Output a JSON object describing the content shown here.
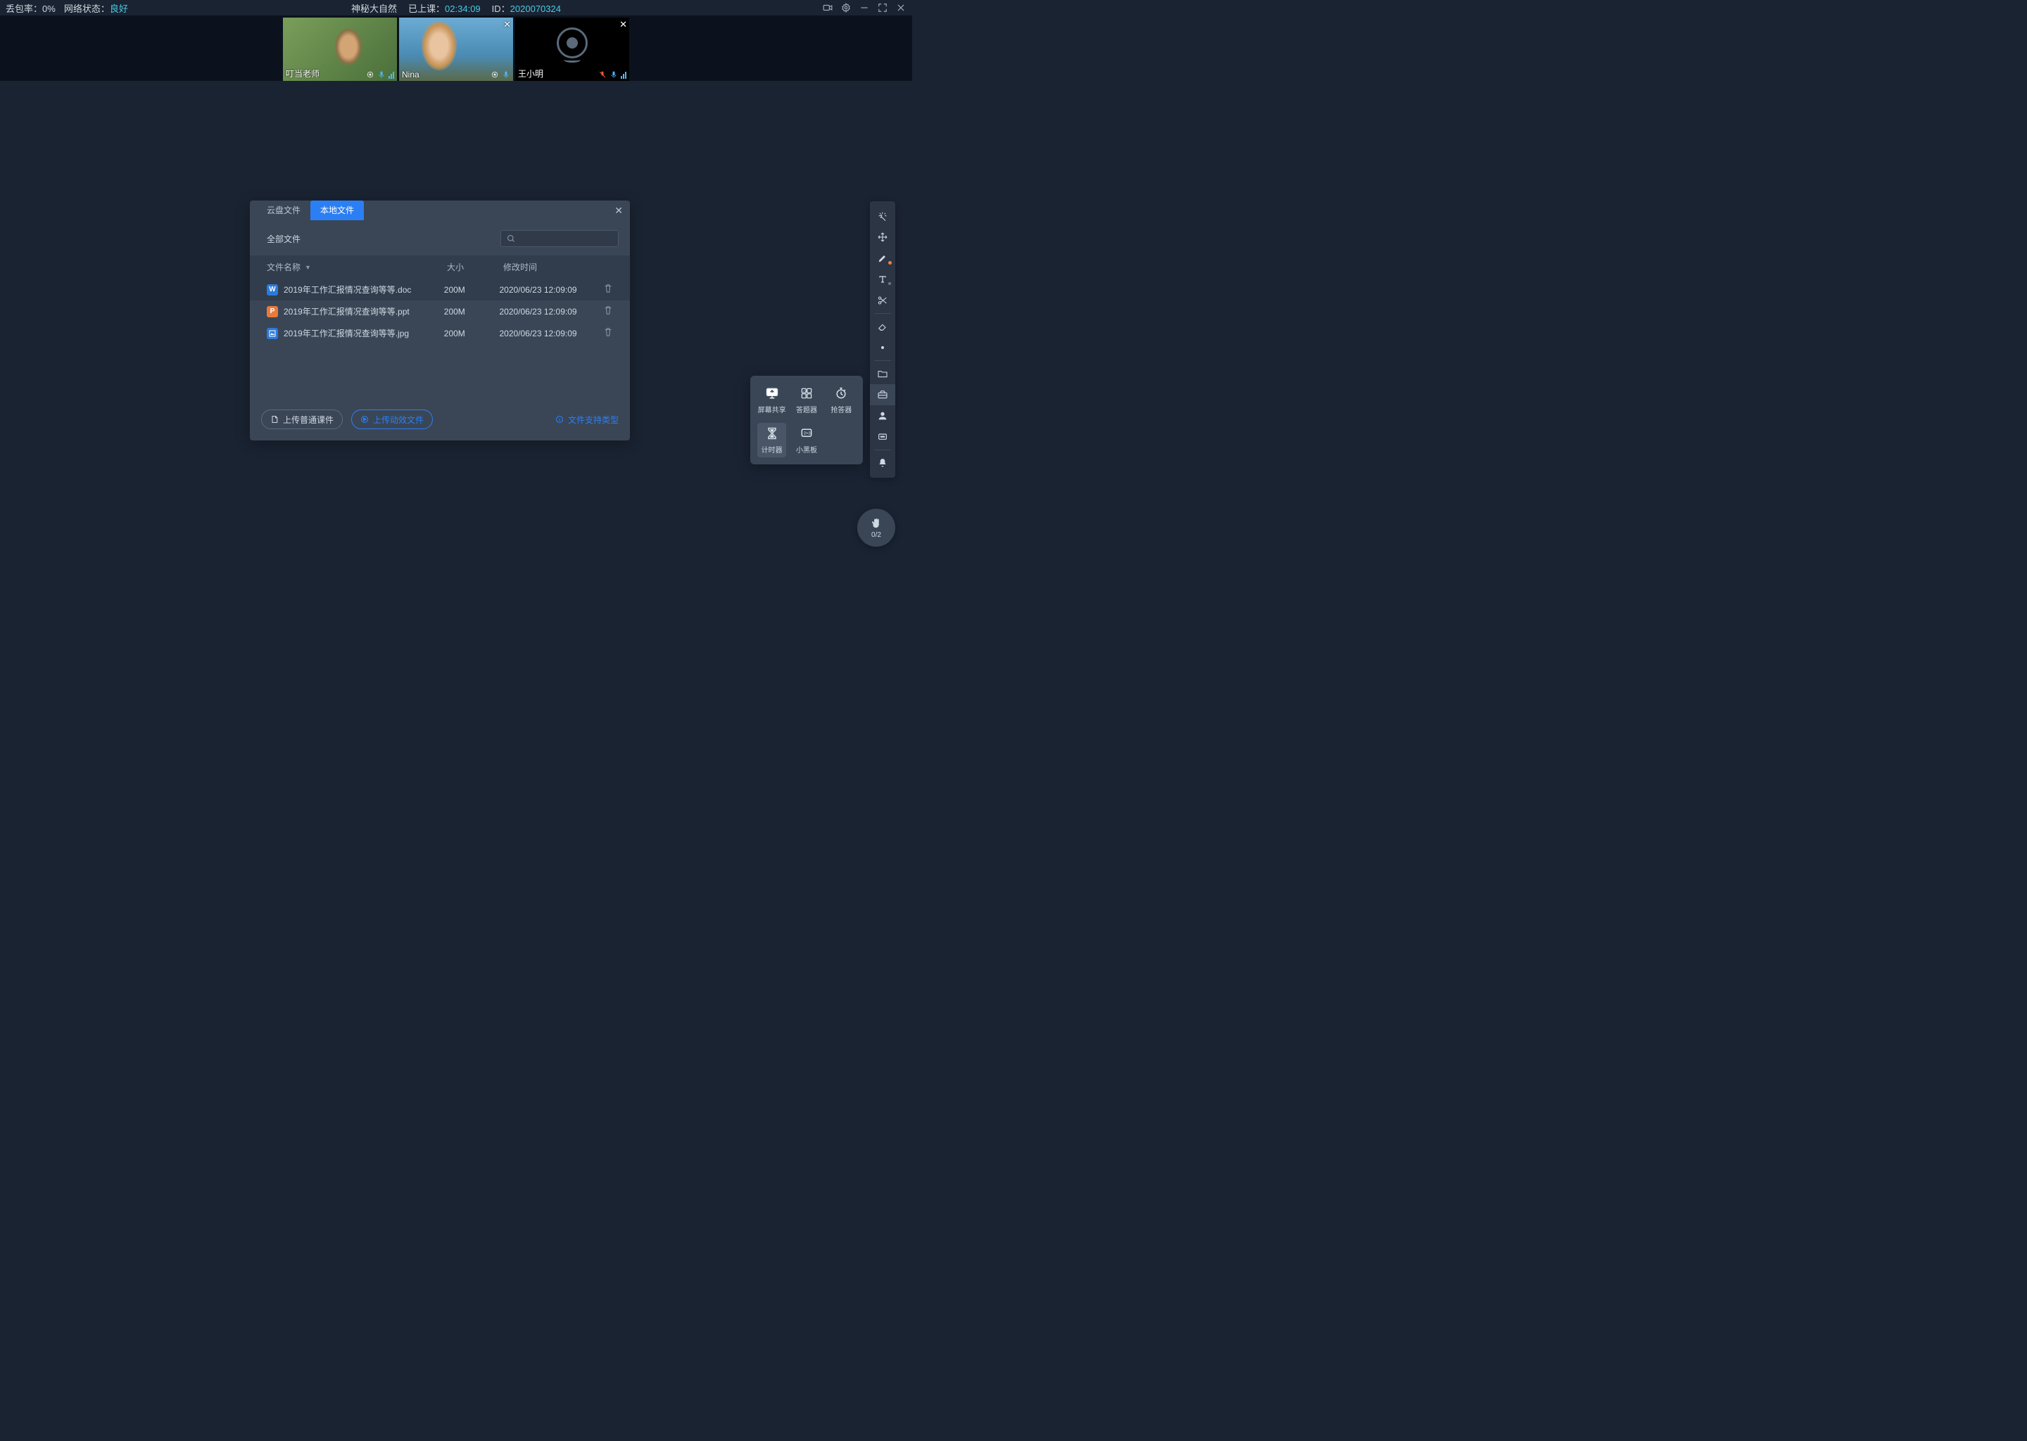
{
  "topbar": {
    "packet_loss_label": "丢包率：",
    "packet_loss_value": "0%",
    "network_label": "网络状态：",
    "network_value": "良好",
    "title": "神秘大自然",
    "elapsed_label": "已上课：",
    "elapsed_value": "02:34:09",
    "id_label": "ID：",
    "id_value": "2020070324"
  },
  "videos": [
    {
      "name": "叮当老师",
      "closable": false,
      "dark": false
    },
    {
      "name": "Nina",
      "closable": true,
      "dark": false
    },
    {
      "name": "王小明",
      "closable": true,
      "dark": true
    }
  ],
  "file_dialog": {
    "tabs": {
      "cloud": "云盘文件",
      "local": "本地文件"
    },
    "active_tab": "local",
    "all_files": "全部文件",
    "columns": {
      "name": "文件名称",
      "size": "大小",
      "time": "修改时间"
    },
    "files": [
      {
        "icon": "W",
        "name": "2019年工作汇报情况查询等等.doc",
        "size": "200M",
        "time": "2020/06/23 12:09:09"
      },
      {
        "icon": "P",
        "name": "2019年工作汇报情况查询等等.ppt",
        "size": "200M",
        "time": "2020/06/23 12:09:09"
      },
      {
        "icon": "▲",
        "name": "2019年工作汇报情况查询等等.jpg",
        "size": "200M",
        "time": "2020/06/23 12:09:09"
      }
    ],
    "upload_normal": "上传普通课件",
    "upload_fx": "上传动效文件",
    "support": "文件支持类型"
  },
  "tools_popup": {
    "screen_share": "屏幕共享",
    "answer": "答题器",
    "race": "抢答器",
    "timer": "计时器",
    "blackboard": "小黑板"
  },
  "raise_hand": {
    "count": "0/2"
  }
}
